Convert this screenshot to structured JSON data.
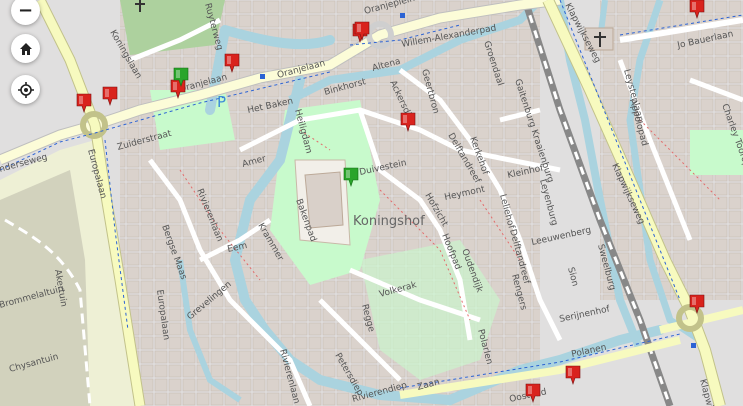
{
  "map": {
    "area_label": "Koningshof",
    "parking_symbol": "P",
    "streets": {
      "koningslaan": "Koningslaan",
      "oranjelaan": "Oranjelaan",
      "willem_alexanderpad": "Willem-Alexanderpad",
      "oranjeplein": "Oranjeplein",
      "altena": "Altena",
      "binkhorst": "Binkhorst",
      "het_baken": "Het Baken",
      "heiligdam": "Heiligdam",
      "zuiderstraat": "Zuiderstraat",
      "europalaan_n": "Europalaan",
      "europalaan_s": "Europalaan",
      "amer": "Amer",
      "rivierenlaan_n": "Rivierenlaan",
      "rivierenlaan_s": "Rivierenlaan",
      "bergse_maas": "Bergse Maas",
      "eem": "Eem",
      "krammer": "Krammer",
      "grevelingen": "Grevelingen",
      "bakenpad": "Bakenpad",
      "duivestein": "Duivestein",
      "geertbron": "Geertbron",
      "ackersdijk": "Ackersdijk",
      "groendaal": "Groendaal",
      "delftandreef_n": "Delftandreef",
      "delftandreef_s": "Delftandreef",
      "kerkehof": "Kerkehof",
      "hofzicht": "Hofzicht",
      "heymont": "Heymont",
      "kleinhof": "Kleinhof",
      "leliehof": "Leliehof",
      "leyenburg": "Leyenburg",
      "oudendijk": "Oudendijk",
      "hoofpad": "Hoofpad",
      "leeuwenberg": "Leeuwenberg",
      "rengers": "Rengers",
      "sion": "Sion",
      "sweelburg": "Sweelburg",
      "serijnenhof": "Serijnenhof",
      "polanen": "Polanen",
      "polarlen": "Polarlen",
      "volkerak": "Volkerak",
      "regge": "Regge",
      "petersdiep": "Petersdiep",
      "rivierendiep": "Rivierendiep",
      "zaan": "Zaan",
      "oostpad": "Oostpad",
      "gaitenburgkade": "Gaitenburg Kraaienburg",
      "klapwijkseweg_n": "Klapwijkseweg",
      "klapwijkseweg_s": "Klapwijkseweg",
      "jo_bauerlaan": "Jo Bauerlaan",
      "charley_toorop": "Charley Tooropl",
      "leystenlaan": "Leystenlaan",
      "appolopad": "Appolopad",
      "ruyterweg": "Ruyterweg",
      "brommelaltuin": "Brommelaltuin",
      "akertuin": "Akertuin",
      "chysantuin": "Chysantuin",
      "ringweg_left": "nderseweg",
      "klapwijk_cut": "Klapwijk"
    }
  },
  "controls": {
    "zoom_out_label": "−",
    "home_icon": "home-icon",
    "locate_icon": "locate-icon"
  },
  "markers": [
    {
      "color": "#d9231d",
      "kind": "red"
    },
    {
      "color": "#d9231d",
      "kind": "red"
    },
    {
      "color": "#d9231d",
      "kind": "red"
    },
    {
      "color": "#d9231d",
      "kind": "red"
    },
    {
      "color": "#d9231d",
      "kind": "red"
    },
    {
      "color": "#d9231d",
      "kind": "red"
    },
    {
      "color": "#d9231d",
      "kind": "red"
    },
    {
      "color": "#d9231d",
      "kind": "red"
    },
    {
      "color": "#d9231d",
      "kind": "red"
    },
    {
      "color": "#d9231d",
      "kind": "red"
    },
    {
      "color": "#d9231d",
      "kind": "red"
    },
    {
      "color": "#2aa52a",
      "kind": "green"
    },
    {
      "color": "#2aa52a",
      "kind": "green"
    }
  ]
}
